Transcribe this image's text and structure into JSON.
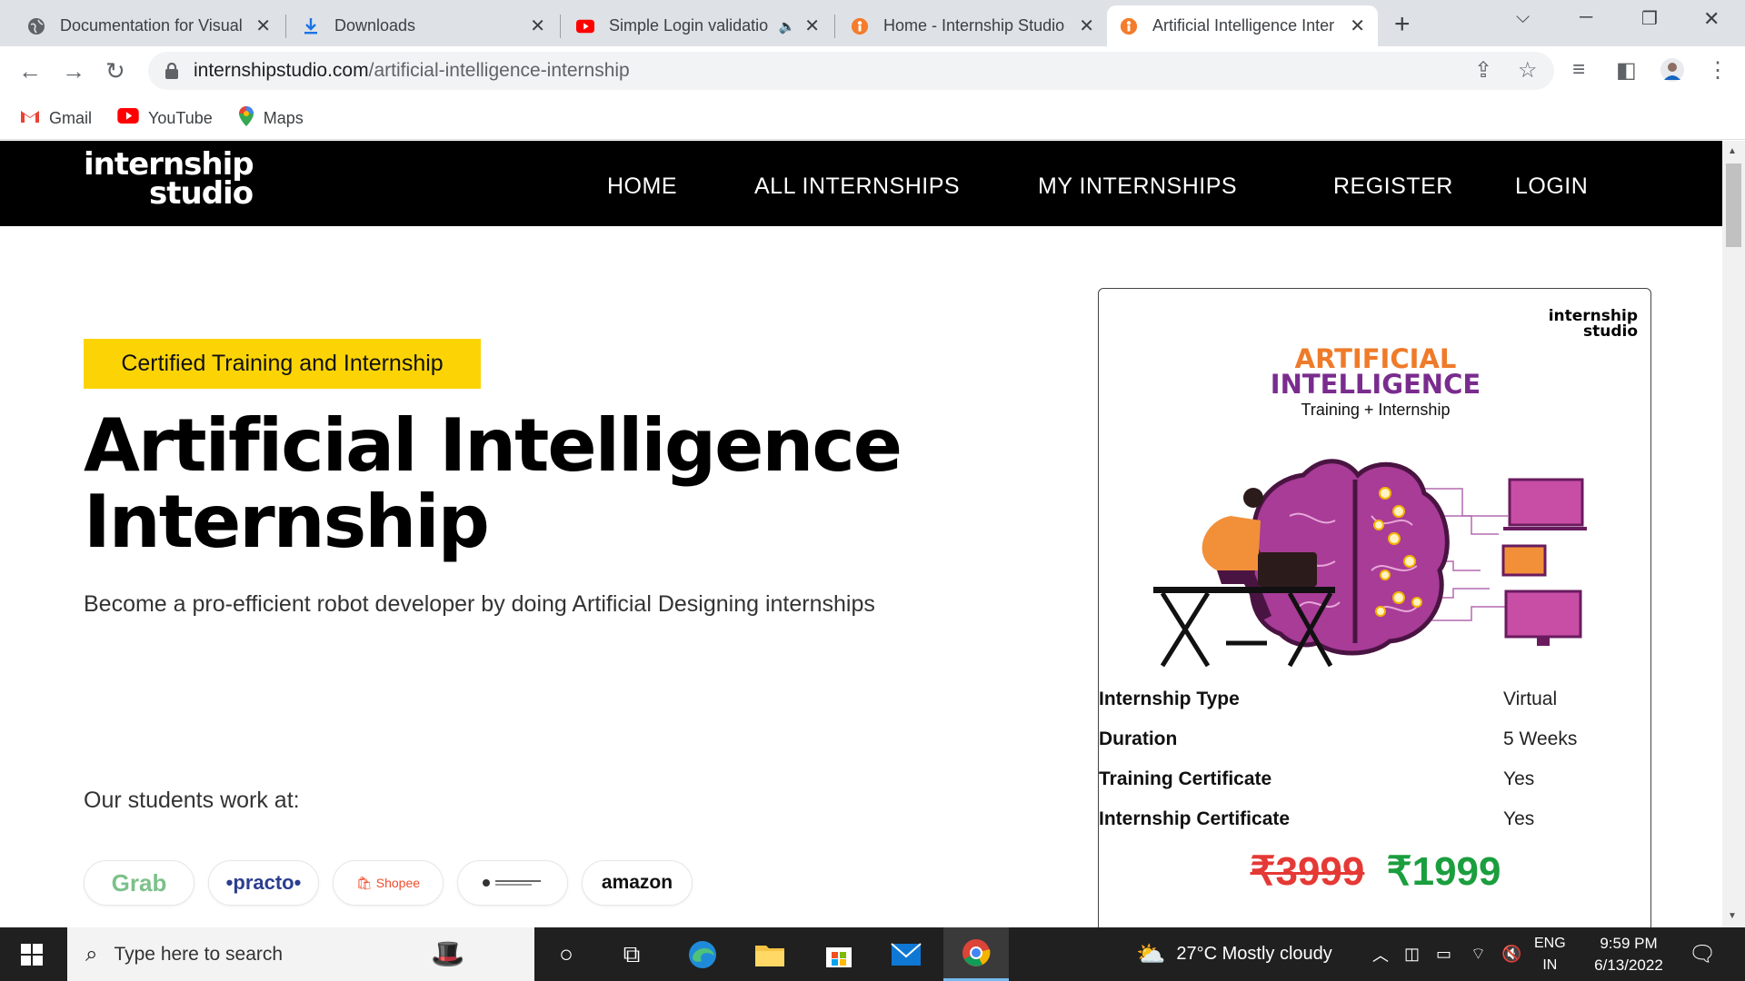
{
  "browser": {
    "tabs": [
      {
        "title": "Documentation for Visual",
        "icon": "globe-icon",
        "active": false
      },
      {
        "title": "Downloads",
        "icon": "download-icon",
        "active": false
      },
      {
        "title": "Simple Login validatio",
        "icon": "youtube-icon",
        "active": false
      },
      {
        "title": "Home - Internship Studio",
        "icon": "internship-studio-icon",
        "active": false
      },
      {
        "title": "Artificial Intelligence Inter",
        "icon": "internship-studio-icon",
        "active": true
      }
    ],
    "url_host": "internshipstudio.com",
    "url_path": "/artificial-intelligence-internship",
    "bookmarks": [
      {
        "label": "Gmail",
        "icon": "gmail-icon"
      },
      {
        "label": "YouTube",
        "icon": "youtube-icon"
      },
      {
        "label": "Maps",
        "icon": "maps-icon"
      }
    ]
  },
  "site": {
    "logo_line1": "internship",
    "logo_line2": "studio",
    "nav": [
      "HOME",
      "ALL INTERNSHIPS",
      "MY INTERNSHIPS",
      "REGISTER",
      "LOGIN"
    ]
  },
  "hero": {
    "badge": "Certified Training and Internship",
    "title_line1": "Artificial Intelligence",
    "title_line2": "Internship",
    "subtitle": "Become a pro-efficient robot developer by doing Artificial Designing internships",
    "students_label": "Our students work at:",
    "companies": [
      "Grab",
      "•practo•",
      "Shopee",
      "",
      "amazon"
    ]
  },
  "card": {
    "logo_line1": "internship",
    "logo_line2": "studio",
    "title_line1": "ARTIFICIAL",
    "title_line2": "INTELLIGENCE",
    "title_line3": "Training + Internship",
    "details": [
      {
        "label": "Internship Type",
        "value": "Virtual"
      },
      {
        "label": "Duration",
        "value": "5 Weeks"
      },
      {
        "label": "Training Certificate",
        "value": "Yes"
      },
      {
        "label": "Internship Certificate",
        "value": "Yes"
      }
    ],
    "old_price": "₹3999",
    "new_price": "₹1999"
  },
  "taskbar": {
    "search_placeholder": "Type here to search",
    "weather": "27°C  Mostly cloudy",
    "lang_line1": "ENG",
    "lang_line2": "IN",
    "time": "9:59 PM",
    "date": "6/13/2022"
  },
  "colors": {
    "badge": "#fcd406",
    "nav_bg": "#000000",
    "ai_orange": "#ef7b2a",
    "ai_purple": "#7a2c8e",
    "old_price": "#e53935",
    "new_price": "#1b9e3e"
  }
}
